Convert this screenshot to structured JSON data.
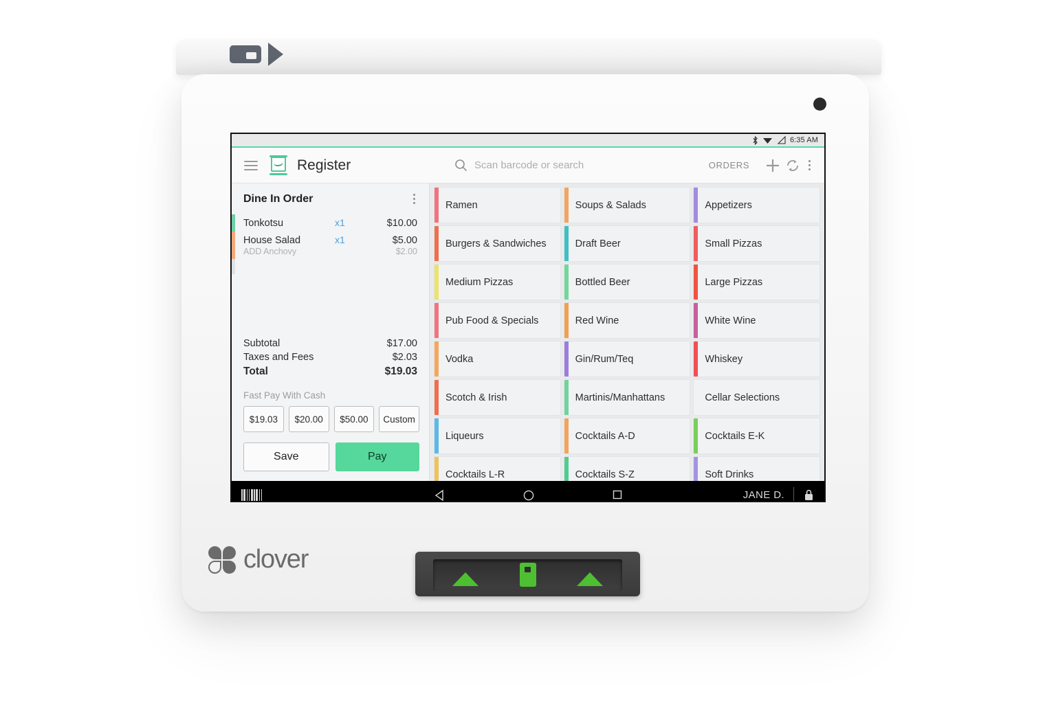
{
  "device": {
    "brand": "clover",
    "top_tab_icons": [
      "card-slot-icon",
      "card-arrow-icon"
    ],
    "camera": "camera-dot",
    "card_reader_icons": [
      "arrow-left",
      "card-insert",
      "arrow-right"
    ]
  },
  "status_bar": {
    "time": "6:35 AM",
    "icons": [
      "bluetooth-icon",
      "wifi-icon",
      "signal-icon"
    ]
  },
  "app_bar": {
    "menu_icon": "hamburger-icon",
    "app_icon": "register-app-icon",
    "title": "Register",
    "search_placeholder": "Scan barcode or search",
    "search_value": "",
    "orders_label": "ORDERS",
    "icons": [
      "search-icon",
      "plus-icon",
      "refresh-icon",
      "overflow-menu-icon"
    ]
  },
  "order": {
    "title": "Dine In Order",
    "menu_icon": "kebab-menu-icon",
    "lines": [
      {
        "name": "Tonkotsu",
        "qty": "x1",
        "price": "$10.00",
        "accent": "#6fcfa6",
        "modifier": null,
        "modifier_price": null
      },
      {
        "name": "House Salad",
        "qty": "x1",
        "price": "$5.00",
        "accent": "#f0a97a",
        "modifier": "ADD Anchovy",
        "modifier_price": "$2.00"
      }
    ],
    "totals": [
      {
        "label": "Subtotal",
        "value": "$17.00",
        "grand": false
      },
      {
        "label": "Taxes and Fees",
        "value": "$2.03",
        "grand": false
      },
      {
        "label": "Total",
        "value": "$19.03",
        "grand": true
      }
    ],
    "fast_pay_label": "Fast Pay With Cash",
    "fast_pay_buttons": [
      "$19.03",
      "$20.00",
      "$50.00",
      "Custom"
    ],
    "save_label": "Save",
    "pay_label": "Pay",
    "pay_color": "#56d79b"
  },
  "categories": [
    {
      "label": "Ramen",
      "accent": "#f0737e"
    },
    {
      "label": "Soups & Salads",
      "accent": "#f3a461"
    },
    {
      "label": "Appetizers",
      "accent": "#a18ce0"
    },
    {
      "label": "Burgers & Sandwiches",
      "accent": "#ef6f4e"
    },
    {
      "label": "Draft Beer",
      "accent": "#3fbfc4"
    },
    {
      "label": "Small Pizzas",
      "accent": "#ef5d5d"
    },
    {
      "label": "Medium Pizzas",
      "accent": "#ece36a"
    },
    {
      "label": "Bottled Beer",
      "accent": "#71d79a"
    },
    {
      "label": "Large Pizzas",
      "accent": "#ef5340"
    },
    {
      "label": "Pub Food & Specials",
      "accent": "#f0737e"
    },
    {
      "label": "Red Wine",
      "accent": "#f0a052"
    },
    {
      "label": "White Wine",
      "accent": "#c5609e"
    },
    {
      "label": "Vodka",
      "accent": "#f3a85a"
    },
    {
      "label": "Gin/Rum/Teq",
      "accent": "#9b7ede"
    },
    {
      "label": "Whiskey",
      "accent": "#ef5055"
    },
    {
      "label": "Scotch & Irish",
      "accent": "#ef6f4e"
    },
    {
      "label": "Martinis/Manhattans",
      "accent": "#6fd49d"
    },
    {
      "label": "Cellar Selections",
      "accent": "#eeb martial"
    },
    {
      "label": "Liqueurs",
      "accent": "#5ab9e8"
    },
    {
      "label": "Cocktails A-D",
      "accent": "#f3a45d"
    },
    {
      "label": "Cocktails E-K",
      "accent": "#79cf5a"
    },
    {
      "label": "Cocktails L-R",
      "accent": "#edc35c"
    },
    {
      "label": "Cocktails S-Z",
      "accent": "#4fcc90"
    },
    {
      "label": "Soft Drinks",
      "accent": "#a394e2"
    }
  ],
  "nav_bar": {
    "barcode_icon": "barcode-icon",
    "back_icon": "back-triangle-icon",
    "home_icon": "home-circle-icon",
    "recents_icon": "recents-square-icon",
    "user": "JANE D.",
    "lock_icon": "lock-icon"
  }
}
